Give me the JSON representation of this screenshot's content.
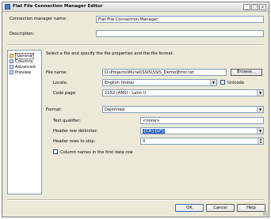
{
  "window": {
    "title": "Flat File Connection Manager Editor",
    "buttons": [
      "_",
      "□",
      "x"
    ]
  },
  "header": {
    "name_label": "Connection manager name:",
    "name_value": "Flat File Connection Manager",
    "description_label": "Description:",
    "description_value": ""
  },
  "sidebar": {
    "items": [
      {
        "label": "General",
        "icon": "general-icon",
        "selected": true
      },
      {
        "label": "Columns",
        "icon": "columns-icon",
        "selected": false
      },
      {
        "label": "Advanced",
        "icon": "advanced-icon",
        "selected": false
      },
      {
        "label": "Preview",
        "icon": "preview-icon",
        "selected": false
      }
    ]
  },
  "general": {
    "intro": "Select a file and specify the file properties and the file format.",
    "file_name_label": "File name:",
    "file_name_value": "D:\\Projects\\Murali\\SSIS\\SSIS_Demo\\Error.txt",
    "browse_label": "Browse...",
    "locale_label": "Locale:",
    "locale_value": "English (India)",
    "unicode_label": "Unicode",
    "unicode_checked": false,
    "code_page_label": "Code page:",
    "code_page_value": "1252  (ANSI - Latin I)",
    "format_label": "Format:",
    "format_value": "Delimited",
    "text_qualifier_label": "Text qualifier:",
    "text_qualifier_value": "<none>",
    "header_row_delimiter_label": "Header row delimiter:",
    "header_row_delimiter_value": "{CR}{LF}",
    "header_rows_skip_label": "Header rows to skip:",
    "header_rows_skip_value": "0",
    "column_names_label": "Column names in the first data row",
    "column_names_checked": false
  },
  "footer": {
    "ok_label": "OK",
    "cancel_label": "Cancel",
    "help_label": "Help"
  }
}
